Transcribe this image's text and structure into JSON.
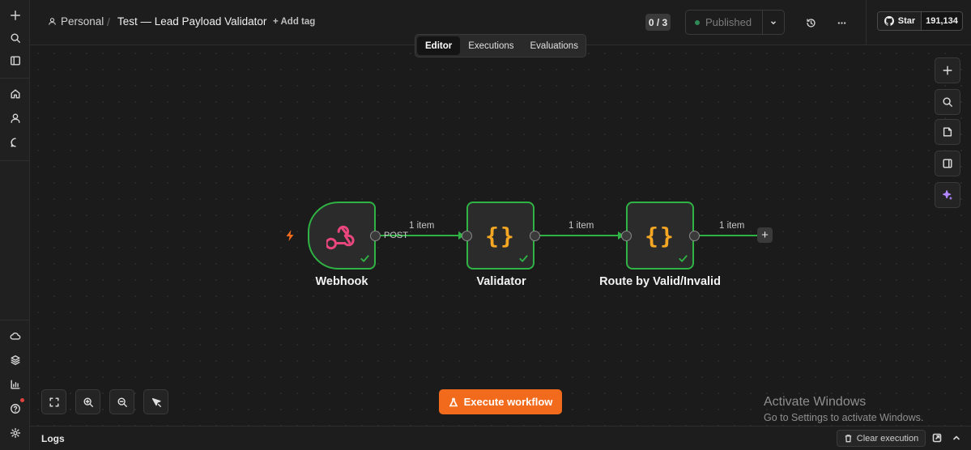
{
  "breadcrumb": {
    "project": "Personal",
    "workflow_title": "Test — Lead Payload Validator",
    "add_tag": "+ Add tag"
  },
  "header": {
    "counter": "0 / 3",
    "status": "Published",
    "github": {
      "star_label": "Star",
      "star_count": "191,134"
    }
  },
  "tabs": [
    {
      "label": "Editor",
      "active": true
    },
    {
      "label": "Executions",
      "active": false
    },
    {
      "label": "Evaluations",
      "active": false
    }
  ],
  "workflow": {
    "nodes": [
      {
        "name": "Webhook",
        "icon": "webhook-icon",
        "status": "success"
      },
      {
        "name": "Validator",
        "icon": "code-braces-icon",
        "status": "success"
      },
      {
        "name": "Route by Valid/Invalid",
        "icon": "code-braces-icon",
        "status": "success"
      }
    ],
    "connections": [
      {
        "label": "1 item",
        "output_label": "POST"
      },
      {
        "label": "1 item"
      },
      {
        "label": "1 item"
      }
    ]
  },
  "actions": {
    "execute_workflow": "Execute workflow"
  },
  "logs": {
    "title": "Logs",
    "clear_execution": "Clear execution"
  },
  "watermark": {
    "line1": "Activate Windows",
    "line2": "Go to Settings to activate Windows."
  },
  "colors": {
    "accent": "#f26b1d",
    "success": "#2fb344",
    "node_code": "#f5a623",
    "webhook": "#e8467c",
    "ai": "#b388ff"
  }
}
